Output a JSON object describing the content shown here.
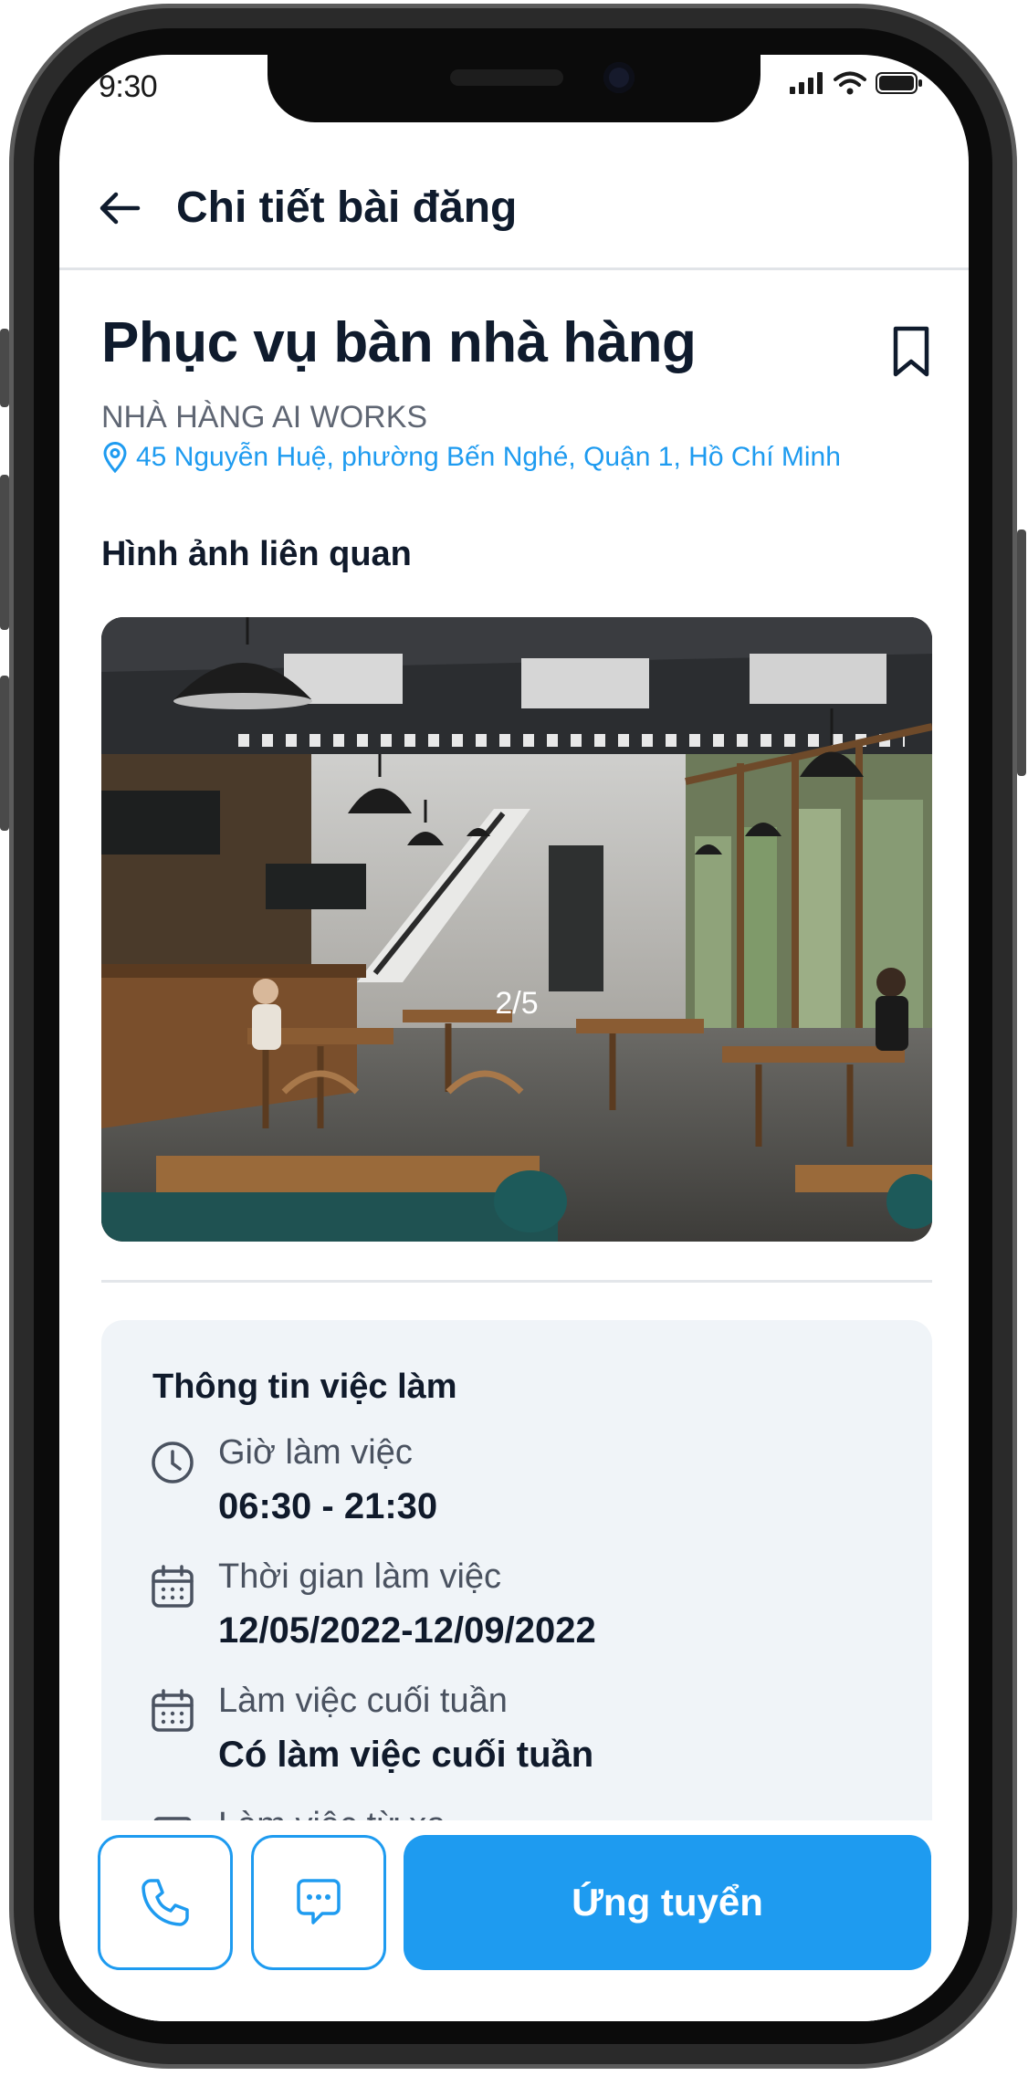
{
  "status_bar": {
    "time": "9:30"
  },
  "header": {
    "title": "Chi tiết bài đăng"
  },
  "job": {
    "title": "Phục vụ bàn nhà hàng",
    "company": "NHÀ HÀNG AI WORKS",
    "address": "45 Nguyễn Huệ, phường Bến Nghé, Quận 1, Hồ Chí Minh"
  },
  "gallery": {
    "label": "Hình ảnh liên quan",
    "counter": "2/5",
    "current": 2,
    "total": 5
  },
  "info": {
    "title": "Thông tin việc làm",
    "rows": [
      {
        "icon": "clock-icon",
        "label": "Giờ làm việc",
        "value": "06:30 - 21:30"
      },
      {
        "icon": "calendar-icon",
        "label": "Thời gian làm việc",
        "value": "12/05/2022-12/09/2022"
      },
      {
        "icon": "calendar-icon",
        "label": "Làm việc cuối tuần",
        "value": "Có làm việc cuối tuần"
      },
      {
        "icon": "laptop-icon",
        "label": "Làm việc từ xa",
        "value": ""
      }
    ]
  },
  "actions": {
    "apply_label": "Ứng tuyển",
    "call_icon": "phone-icon",
    "chat_icon": "chat-icon"
  },
  "colors": {
    "accent": "#1e9bf0",
    "text_dark": "#0f1b2d",
    "card_bg": "#f0f4f8"
  }
}
